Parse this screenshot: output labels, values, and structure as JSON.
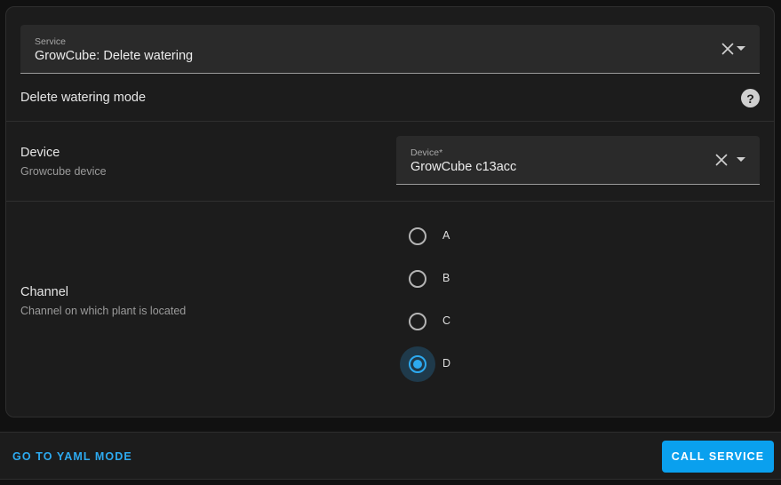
{
  "service_field": {
    "label": "Service",
    "value": "GrowCube: Delete watering"
  },
  "service_description": "Delete watering mode",
  "device_row": {
    "title": "Device",
    "subtitle": "Growcube device",
    "field_label": "Device*",
    "field_value": "GrowCube c13acc"
  },
  "channel_row": {
    "title": "Channel",
    "subtitle": "Channel on which plant is located",
    "options": [
      {
        "label": "A",
        "checked": false
      },
      {
        "label": "B",
        "checked": false
      },
      {
        "label": "C",
        "checked": false
      },
      {
        "label": "D",
        "checked": true
      }
    ]
  },
  "footer": {
    "yaml_label": "GO TO YAML MODE",
    "call_label": "CALL SERVICE"
  },
  "colors": {
    "accent": "#2daaf0",
    "primary_button": "#0aa0ee",
    "card_background": "#1c1c1c",
    "field_background": "#2a2a2a"
  },
  "icons": {
    "clear": "close-icon",
    "dropdown": "menu-down-icon",
    "help": "help-circle-icon"
  }
}
